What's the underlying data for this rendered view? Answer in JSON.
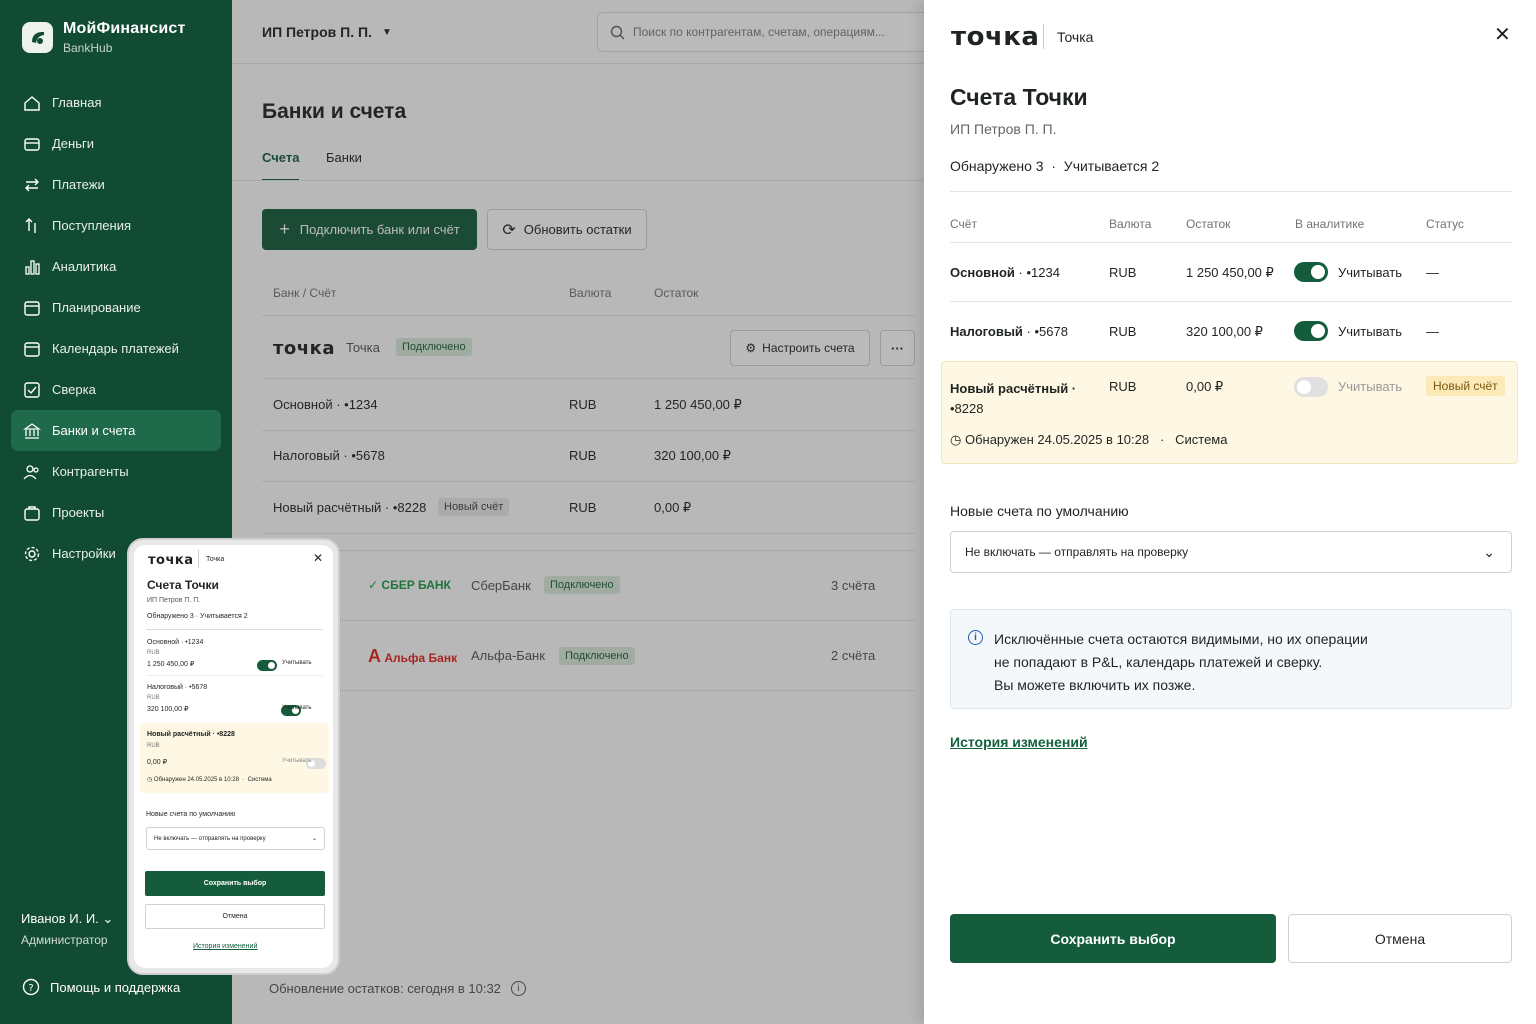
{
  "sidebar": {
    "brand": "МойФинансист",
    "brand_sub": "BankHub",
    "items": [
      {
        "label": "Главная",
        "icon": "home-icon"
      },
      {
        "label": "Деньги",
        "icon": "wallet-icon"
      },
      {
        "label": "Платежи",
        "icon": "transfer-icon"
      },
      {
        "label": "Поступления",
        "icon": "income-icon"
      },
      {
        "label": "Аналитика",
        "icon": "chart-icon"
      },
      {
        "label": "Планирование",
        "icon": "calendar-icon"
      },
      {
        "label": "Календарь платежей",
        "icon": "calendar-icon"
      },
      {
        "label": "Сверка",
        "icon": "reconcile-icon"
      },
      {
        "label": "Банки и счета",
        "icon": "bank-icon"
      },
      {
        "label": "Контрагенты",
        "icon": "users-icon"
      },
      {
        "label": "Проекты",
        "icon": "briefcase-icon"
      },
      {
        "label": "Настройки",
        "icon": "gear-icon"
      }
    ],
    "active_index": 8,
    "user_name": "Иванов И. И.",
    "user_role": "Администратор",
    "help": "Помощь и поддержка"
  },
  "topbar": {
    "company": "ИП Петров П. П.",
    "search_placeholder": "Поиск по контрагентам, счетам, операциям..."
  },
  "main": {
    "title": "Банки и счета",
    "tabs": [
      "Счета",
      "Банки"
    ],
    "connect_button": "Подключить банк или счёт",
    "refresh_button": "Обновить остатки",
    "columns": [
      "Банк / Счёт",
      "Валюта",
      "Остаток"
    ],
    "tochka": {
      "logo": "точка",
      "name": "Точка",
      "status": "Подключено",
      "configure": "Настроить счета",
      "accounts": [
        {
          "name": "Основной · •1234",
          "currency": "RUB",
          "balance": "1 250 450,00 ₽",
          "badge": ""
        },
        {
          "name": "Налоговый · •5678",
          "currency": "RUB",
          "balance": "320 100,00 ₽",
          "badge": ""
        },
        {
          "name": "Новый расчётный · •8228",
          "currency": "RUB",
          "balance": "0,00 ₽",
          "badge": "Новый счёт"
        }
      ]
    },
    "sber": {
      "logo": "СБЕР БАНК",
      "name": "СберБанк",
      "status": "Подключено",
      "count": "3 счёта"
    },
    "alfa": {
      "logo": "Альфа Банк",
      "name": "Альфа-Банк",
      "status": "Подключено",
      "count": "2 счёта"
    },
    "footer": "Обновление остатков: сегодня в 10:32"
  },
  "panel": {
    "logo": "точка",
    "bank": "Точка",
    "title": "Счета Точки",
    "subtitle": "ИП Петров П. П.",
    "summary_found": "Обнаружено 3",
    "summary_counted": "Учитывается 2",
    "columns": [
      "Счёт",
      "Валюта",
      "Остаток",
      "В аналитике",
      "Статус"
    ],
    "accounts": [
      {
        "name": "Основной",
        "suffix": "· •1234",
        "currency": "RUB",
        "balance": "1 250 450,00 ₽",
        "toggle_label": "Учитывать",
        "enabled": true,
        "status": "—"
      },
      {
        "name": "Налоговый",
        "suffix": "· •5678",
        "currency": "RUB",
        "balance": "320 100,00 ₽",
        "toggle_label": "Учитывать",
        "enabled": true,
        "status": "—"
      },
      {
        "name": "Новый расчётный ·",
        "suffix": "•8228",
        "currency": "RUB",
        "balance": "0,00 ₽",
        "toggle_label": "Учитывать",
        "enabled": false,
        "status": "Новый счёт"
      }
    ],
    "detected": "Обнаружен 24.05.2025 в 10:28",
    "detected_by": "Система",
    "default_label": "Новые счета по умолчанию",
    "default_value": "Не включать — отправлять на проверку",
    "info_lines": [
      "Исключённые счета остаются видимыми, но их операции",
      "не попадают в P&L, календарь платежей и сверку.",
      "Вы можете включить их позже."
    ],
    "history": "История изменений",
    "save": "Сохранить выбор",
    "cancel": "Отмена"
  },
  "mobile": {
    "logo": "точка",
    "bank": "Точка",
    "title": "Счета Точки",
    "subtitle": "ИП Петров П. П.",
    "summary": "Обнаружено 3 · Учитывается 2",
    "accounts": [
      {
        "name": "Основной · •1234",
        "currency": "RUB",
        "balance": "1 250 450,00 ₽",
        "toggle_label": "Учитывать"
      },
      {
        "name": "Налоговый · •5678",
        "currency": "RUB",
        "balance": "320 100,00 ₽",
        "toggle_label": "Учитывать"
      },
      {
        "name": "Новый расчётный · •8228",
        "currency": "RUB",
        "balance": "0,00 ₽",
        "toggle_label": "Учитывать"
      }
    ],
    "detected": "Обнаружен 24.05.2025 в 10:28",
    "detected_by": "Система",
    "default_label": "Новые счета по умолчанию",
    "default_value": "Не включать — отправлять на проверку",
    "save": "Сохранить выбор",
    "cancel": "Отмена",
    "history": "История изменений"
  },
  "colors": {
    "brand_green": "#114b33",
    "primary": "#155c3c",
    "highlight": "#fdf7e4",
    "new_badge": "#fbe9b7"
  }
}
